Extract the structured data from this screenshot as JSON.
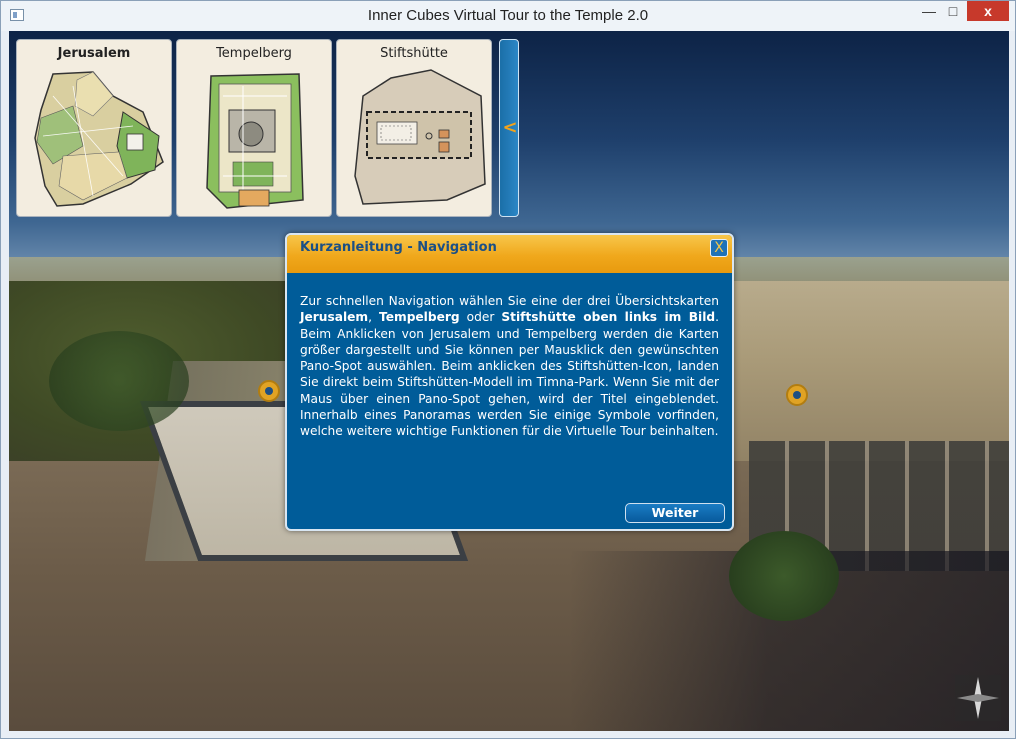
{
  "window": {
    "title": "Inner Cubes Virtual Tour to the Temple 2.0",
    "minimize_glyph": "—",
    "maximize_glyph": "□",
    "close_glyph": "x"
  },
  "maps": [
    {
      "label": "Jerusalem",
      "active": true
    },
    {
      "label": "Tempelberg",
      "active": false
    },
    {
      "label": "Stiftshütte",
      "active": false
    }
  ],
  "collapse_tab": {
    "glyph": "<"
  },
  "dialog": {
    "title": "Kurzanleitung - Navigation",
    "close_glyph": "X",
    "body": {
      "t1": "Zur schnellen Navigation wählen Sie eine der drei Übersichtskarten ",
      "b1": "Jerusalem",
      "t2": ", ",
      "b2": "Tempelberg",
      "t3": " oder ",
      "b3": "Stiftshütte oben links im Bild",
      "t4": ". Beim Anklicken von Jerusalem und Tempelberg werden die Karten größer dargestellt und Sie können per Mausklick den gewünschten Pano-Spot auswählen. Beim anklicken des Stiftshütten-Icon, landen Sie direkt beim Stiftshütten-Modell im Timna-Park. Wenn Sie mit der Maus über einen Pano-Spot gehen, wird der Titel eingeblendet. Innerhalb eines Panoramas werden Sie einige Symbole vorfinden, welche weitere wichtige Funktionen für die Virtuelle Tour beinhalten."
    },
    "button_label": "Weiter"
  },
  "colors": {
    "dialog_bg": "#005c99",
    "header_orange": "#f0a81c",
    "pano_spot": "#e0a324",
    "close_red": "#c7392b"
  },
  "icons": [
    "app-icon",
    "close-icon",
    "chevron-left-icon",
    "compass-icon",
    "pano-spot-icon"
  ]
}
